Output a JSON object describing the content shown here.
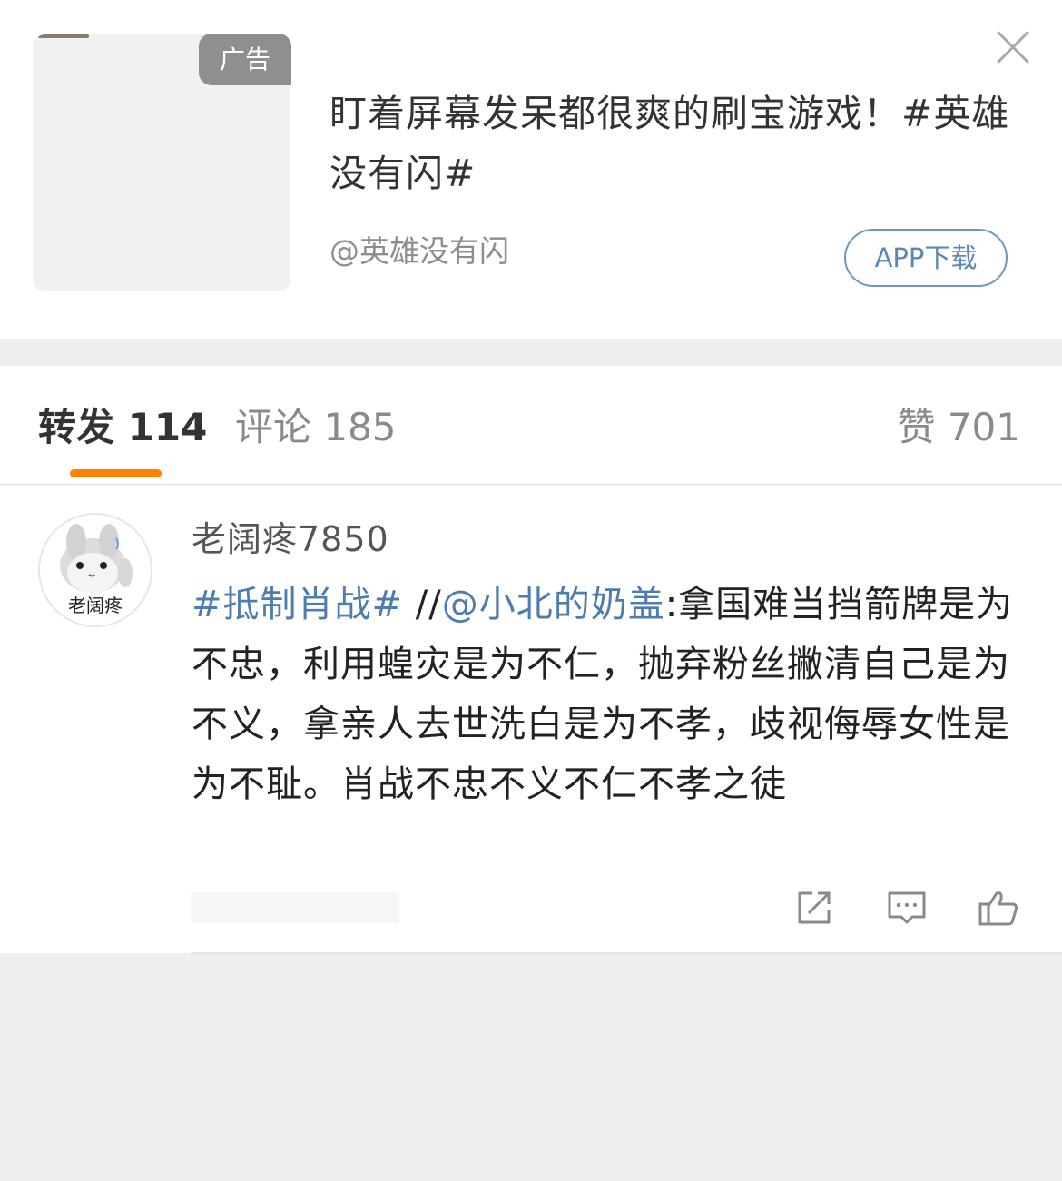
{
  "ad": {
    "badge": "广告",
    "title": "盯着屏幕发呆都很爽的刷宝游戏！#英雄没有闪#",
    "source": "@英雄没有闪",
    "app_button": "APP下载",
    "icons": {
      "close": "close-icon"
    }
  },
  "tabs": {
    "repost": "转发 114",
    "comment": "评论 185",
    "like": "赞 701",
    "active": "repost",
    "indicator_color": "#ff8200"
  },
  "repost": {
    "username": "老阔疼7850",
    "avatar_caption": "老阔疼",
    "topic": "#抵制肖战#",
    "separator": " //",
    "mention": "@小北的奶盖",
    "text": ":拿国难当挡箭牌是为不忠，利用蝗灾是为不仁，抛弃粉丝撇清自己是为不义，拿亲人去世洗白是为不孝，歧视侮辱女性是为不耻。肖战不忠不义不仁不孝之徒",
    "actions": [
      "share-icon",
      "comment-icon",
      "like-icon"
    ]
  },
  "colors": {
    "link": "#4f7cae",
    "button_border": "#6b97c0",
    "background": "#efefef"
  }
}
